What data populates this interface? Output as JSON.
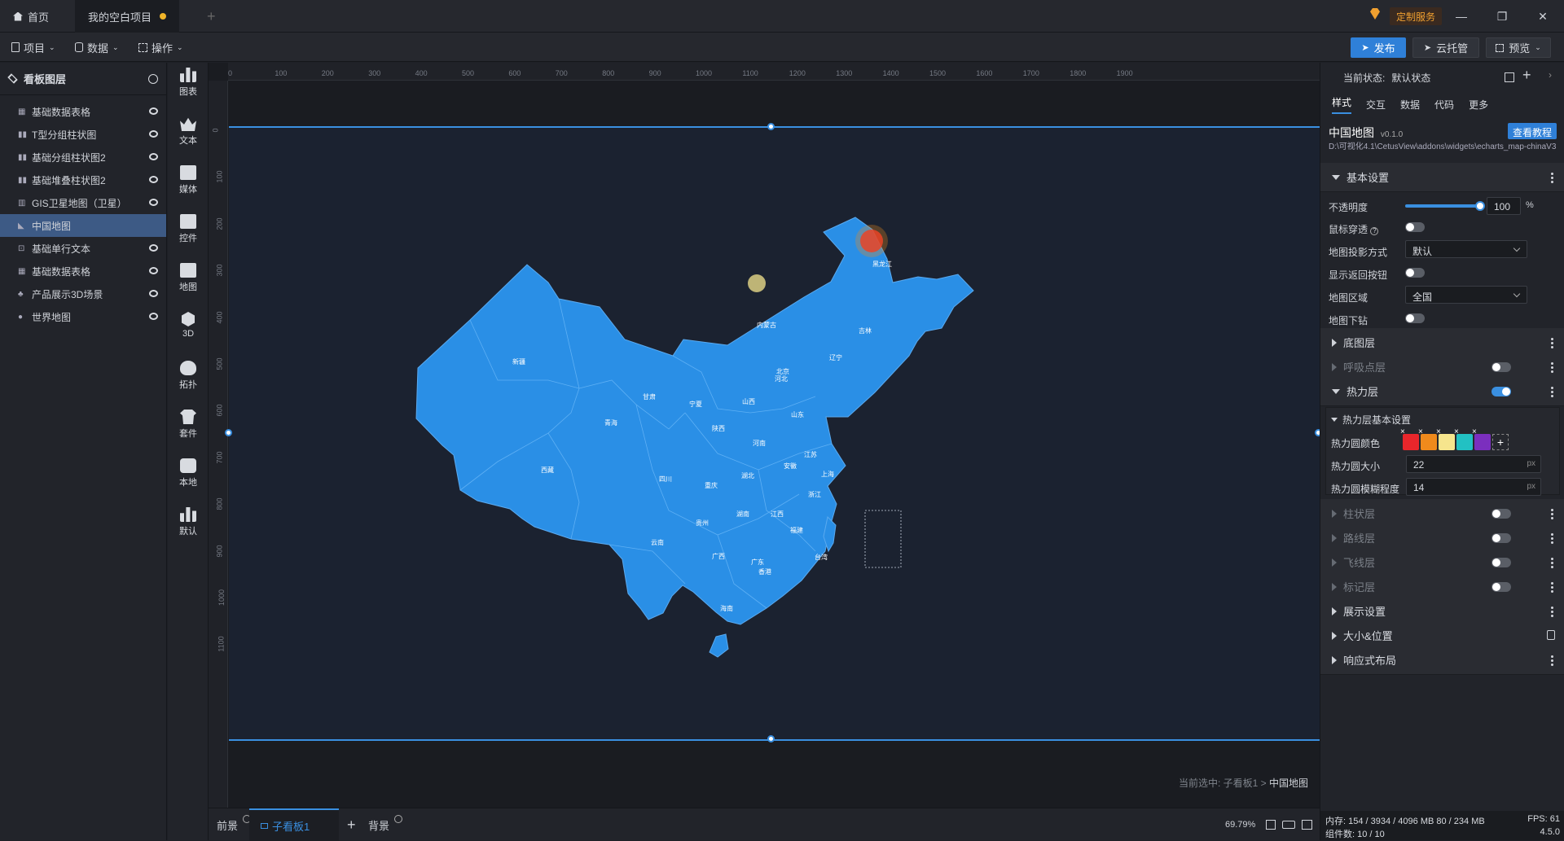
{
  "titlebar": {
    "tabs": [
      {
        "label": "首页"
      },
      {
        "label": "我的空白项目"
      }
    ],
    "service_label": "定制服务"
  },
  "toolbar": {
    "menus": [
      "项目",
      "数据",
      "操作"
    ],
    "publish_label": "发布",
    "cloud_label": "云托管",
    "preview_label": "预览"
  },
  "layers": {
    "title": "看板图层",
    "items": [
      "基础数据表格",
      "T型分组柱状图",
      "基础分组柱状图2",
      "基础堆叠柱状图2",
      "GIS卫星地图（卫星）",
      "中国地图",
      "基础单行文本",
      "基础数据表格",
      "产品展示3D场景",
      "世界地图"
    ]
  },
  "rail": {
    "items": [
      "图表",
      "文本",
      "媒体",
      "控件",
      "地图",
      "3D",
      "拓扑",
      "套件",
      "本地",
      "默认"
    ]
  },
  "canvas": {
    "ruler_h": [
      "0",
      "100",
      "200",
      "300",
      "400",
      "500",
      "600",
      "700",
      "800",
      "900",
      "1000",
      "1100",
      "1200",
      "1300",
      "1400",
      "1500",
      "1600",
      "1700",
      "1800",
      "1900"
    ],
    "ruler_v": [
      "0",
      "100",
      "200",
      "300",
      "400",
      "500",
      "600",
      "700",
      "800",
      "900",
      "1000",
      "1100"
    ],
    "crumb_prefix": "当前选中: 子看板1 >",
    "crumb_current": "中国地图",
    "map_labels": [
      "新疆",
      "西藏",
      "青海",
      "甘肃",
      "内蒙古",
      "黑龙江",
      "吉林",
      "辽宁",
      "北京",
      "河北",
      "山西",
      "宁夏",
      "陕西",
      "河南",
      "山东",
      "江苏",
      "安徽",
      "上海",
      "湖北",
      "四川",
      "重庆",
      "浙江",
      "湖南",
      "江西",
      "福建",
      "台湾",
      "贵州",
      "云南",
      "广西",
      "广东",
      "香港",
      "海南"
    ]
  },
  "bottombar": {
    "front_label": "前景",
    "board_label": "子看板1",
    "back_label": "背景",
    "zoom": "69.79%"
  },
  "right": {
    "state_label": "当前状态:",
    "state_value": "默认状态",
    "tabs": [
      "样式",
      "交互",
      "数据",
      "代码",
      "更多"
    ],
    "widget_name": "中国地图",
    "widget_version": "v0.1.0",
    "tutorial_label": "查看教程",
    "widget_path": "D:\\可视化4.1\\CetusView\\addons\\widgets\\echarts_map-chinaV3",
    "basic": {
      "title": "基本设置",
      "opacity_label": "不透明度",
      "opacity_value": "100",
      "opacity_unit": "%",
      "opacity_level": 1.0,
      "mouse_through_label": "鼠标穿透",
      "projection_label": "地图投影方式",
      "projection_value": "默认",
      "back_button_label": "显示返回按钮",
      "region_label": "地图区域",
      "region_value": "全国",
      "drill_label": "地图下钻"
    },
    "sections": {
      "base_layer": "底图层",
      "breath_layer": "呼吸点层",
      "heat_layer": "热力层",
      "heat_basic": "热力层基本设置",
      "heat_color_label": "热力圆颜色",
      "heat_size_label": "热力圆大小",
      "heat_size_value": "22",
      "heat_blur_label": "热力圆模糊程度",
      "heat_blur_value": "14",
      "px": "px",
      "bar_layer": "柱状层",
      "route_layer": "路线层",
      "fly_layer": "飞线层",
      "marker_layer": "标记层",
      "display": "展示设置",
      "size_pos": "大小&位置",
      "responsive": "响应式布局"
    },
    "heat_colors": [
      "#e8262b",
      "#f08a1c",
      "#f6e58d",
      "#22c1c3",
      "#7b2fbe"
    ],
    "status": {
      "mem_label": "内存:",
      "mem_value": "154 / 3934 / 4096 MB",
      "mem_value2": "80 / 234 MB",
      "fps_label": "FPS:",
      "fps_value": "61",
      "count_label": "组件数:",
      "count_value": "10 / 10",
      "version": "4.5.0"
    }
  }
}
